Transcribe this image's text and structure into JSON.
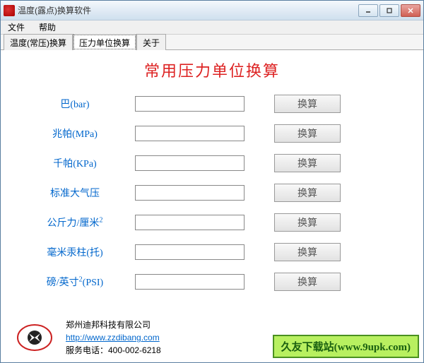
{
  "window": {
    "title": "温度(露点)换算软件"
  },
  "menu": {
    "file": "文件",
    "help": "帮助"
  },
  "tabs": {
    "tab1": "温度(常压)换算",
    "tab2": "压力单位换算",
    "tab3": "关于"
  },
  "page": {
    "title": "常用压力单位换算"
  },
  "rows": [
    {
      "label": "巴(bar)",
      "value": "",
      "btn": "换算"
    },
    {
      "label": "兆帕(MPa)",
      "value": "",
      "btn": "换算"
    },
    {
      "label": "千帕(KPa)",
      "value": "",
      "btn": "换算"
    },
    {
      "label": "标准大气压",
      "value": "",
      "btn": "换算"
    },
    {
      "label_pre": "公斤力/厘米",
      "label_sup": "2",
      "value": "",
      "btn": "换算"
    },
    {
      "label": "毫米汞柱(托)",
      "value": "",
      "btn": "换算"
    },
    {
      "label_pre": "磅/英寸",
      "label_sup": "2",
      "label_post": "(PSI)",
      "value": "",
      "btn": "换算"
    }
  ],
  "footer": {
    "company": "郑州迪邦科技有限公司",
    "url": "http://www.zzdibang.com",
    "phone": "服务电话：400-002-6218"
  },
  "watermark": {
    "name": "久友下载站",
    "url": "(www.9upk.com)"
  }
}
